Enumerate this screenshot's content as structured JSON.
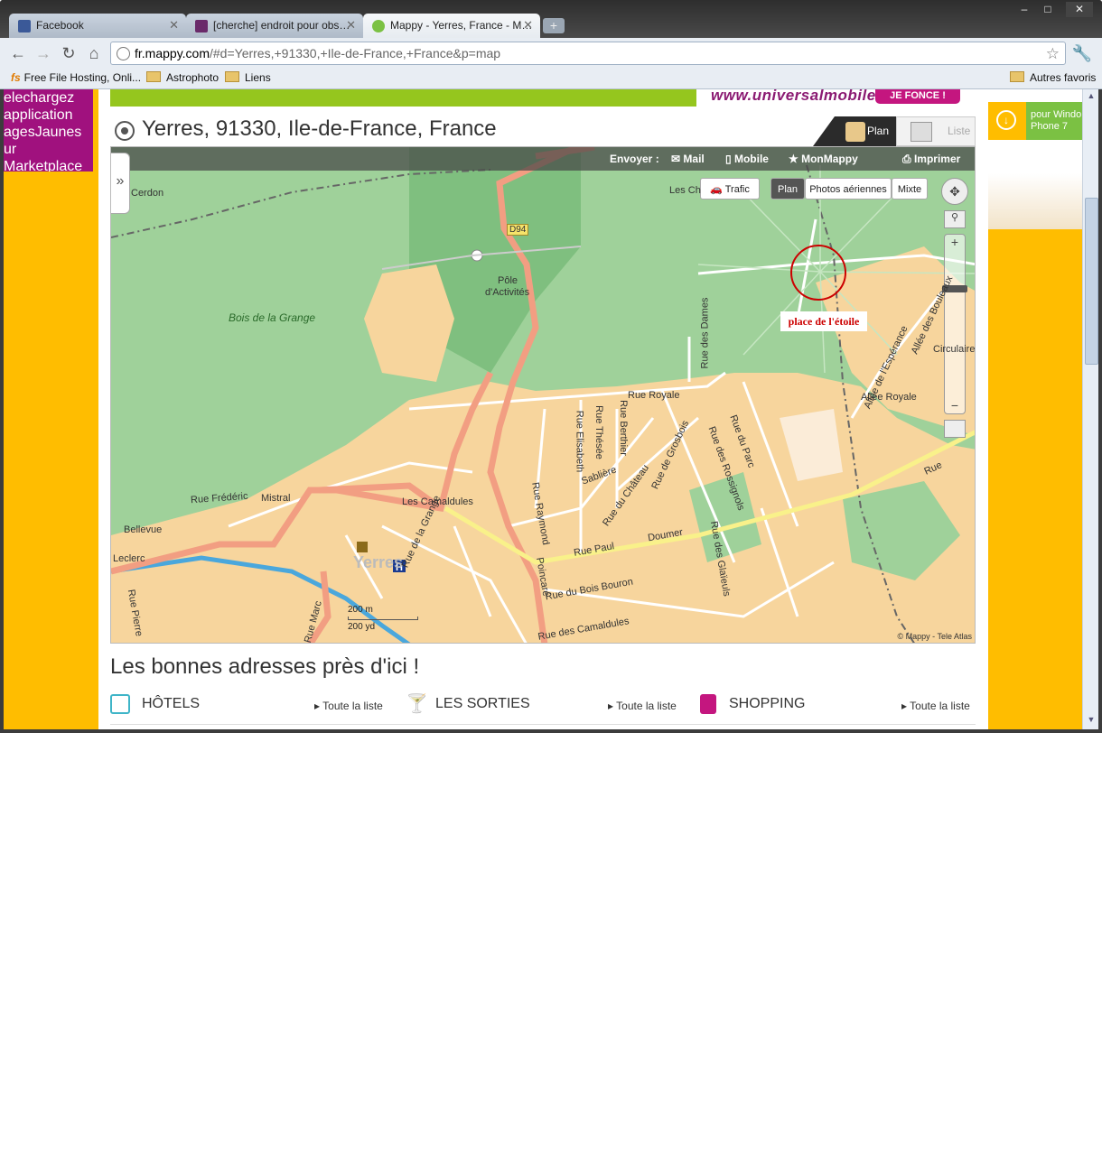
{
  "browser": {
    "tabs": [
      {
        "label": "Facebook",
        "favicon_color": "#3b5998"
      },
      {
        "label": "[cherche] endroit pour obs…",
        "favicon_color": "#6a2a6a"
      },
      {
        "label": "Mappy - Yerres, France - M…",
        "favicon_color": "#7bc143"
      }
    ],
    "new_tab": "+",
    "window_controls": {
      "minimize": "–",
      "maximize": "□",
      "close": "✕"
    },
    "url_host": "fr.mappy.com",
    "url_path": "/#d=Yerres,+91330,+Ile-de-France,+France&p=map",
    "bookmarks": [
      "Free File Hosting, Onli...",
      "Astrophoto",
      "Liens"
    ],
    "other_bookmarks": "Autres favoris"
  },
  "left_ad": {
    "text": "elechargez\napplication\nagesJaunes\nur\nMarketplace"
  },
  "banner": {
    "text": "www.universalmobile.fr",
    "button": "JE FONCE !"
  },
  "location": {
    "title": "Yerres, 91330, Ile-de-France, France"
  },
  "view_toggle": {
    "plan": "Plan",
    "liste": "Liste"
  },
  "map_toolbar": {
    "envoyer": "Envoyer :",
    "mail": "Mail",
    "mobile": "Mobile",
    "monmappy": "MonMappy",
    "imprimer": "Imprimer"
  },
  "map_modes": {
    "trafic": "Trafic",
    "plan": "Plan",
    "photos": "Photos aériennes",
    "mixte": "Mixte"
  },
  "map_labels": {
    "cerdon": "Cerdon",
    "d94": "D94",
    "pole": "Pôle",
    "activites": "d'Activités",
    "bois_grange": "Bois de la Grange",
    "les_ch": "Les Ch",
    "rue_royale": "Rue Royale",
    "allee_royale": "Allée Royale",
    "les_camaldules": "Les Camaldules",
    "rue_frederic": "Rue Frédéric",
    "mistral": "Mistral",
    "bellevue": "Bellevue",
    "leclerc": "Leclerc",
    "yerres": "Yerres",
    "rue_paul": "Rue Paul",
    "doumer": "Doumer",
    "rue_du_bois_bouron": "Rue du Bois Bouron",
    "rue_des_camaldules": "Rue des Camaldules",
    "rue_raymond": "Rue Raymond",
    "poincare": "Poincaré",
    "rue_des_dames": "Rue des Dames",
    "rue_du_parc": "Rue du Parc",
    "rue_des_rossignols": "Rue des Rossignols",
    "rue_de_la_grange": "Rue de la Grange",
    "circulaire": "Circulaire",
    "rue_des_glaieuls": "Rue des Glaïeuls",
    "allee_des_bouleaux": "Allée des Bouleaux",
    "allee_de_l_esperance": "Allée de l'Espérance",
    "rue": "Rue",
    "rue_pierre": "Rue Pierre",
    "rue_marc": "Rue Marc",
    "rue_elisabeth": "Rue Elisabeth",
    "rue_these": "Rue Thésée",
    "rue_berthier": "Rue Berthier",
    "rue_de_grosbois": "Rue de Grosbois",
    "rue_du_chateau": "Rue du Château",
    "sabliere": "Sablière"
  },
  "annotation": "place de l'étoile",
  "scale": {
    "metric": "200 m",
    "imperial": "200 yd"
  },
  "copyright": "© Mappy - Tele Atlas",
  "section_title": "Les bonnes adresses près d'ici !",
  "categories": [
    {
      "label": "HÔTELS",
      "link": "Toute la liste",
      "color": "#3fb5c8"
    },
    {
      "label": "LES SORTIES",
      "link": "Toute la liste",
      "color": "#b02a8a"
    },
    {
      "label": "SHOPPING",
      "link": "Toute la liste",
      "color": "#c4167f"
    }
  ],
  "right_ad": {
    "text": "pour Windo\nPhone 7"
  }
}
